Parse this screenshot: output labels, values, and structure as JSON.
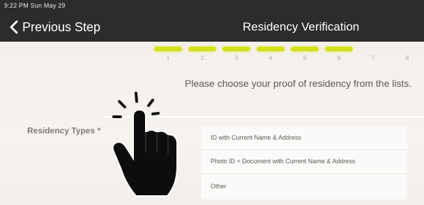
{
  "status_bar": {
    "time": "9:22 PM  Sun May 29"
  },
  "header": {
    "back_label": "Previous Step",
    "title": "Residency Verification",
    "back_icon": "chevron-left-icon",
    "background": "#2c2c2e"
  },
  "steps": {
    "accent": "#d4e11a",
    "items": [
      {
        "label": "1",
        "active": true
      },
      {
        "label": "2",
        "active": true
      },
      {
        "label": "3",
        "active": true
      },
      {
        "label": "4",
        "active": true
      },
      {
        "label": "5",
        "active": true
      },
      {
        "label": "6",
        "active": true
      },
      {
        "label": "7",
        "active": false
      },
      {
        "label": "8",
        "active": false
      }
    ]
  },
  "main": {
    "instruction": "Please choose your proof of residency from the lists.",
    "types_label": "Residency Types *",
    "options": [
      "ID with Current Name & Address",
      "Photo ID + Document with Current Name & Address",
      "Other"
    ]
  },
  "overlay": {
    "icon": "pointing-hand-icon"
  }
}
